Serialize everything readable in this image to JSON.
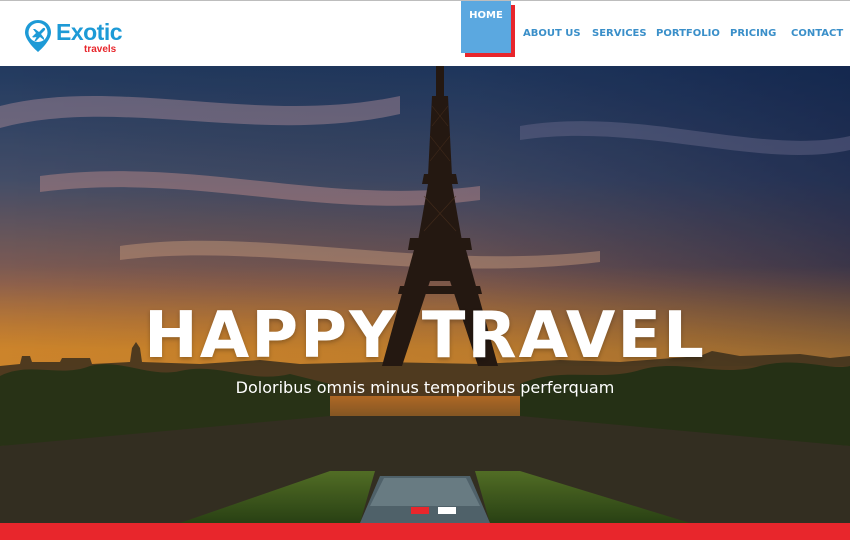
{
  "brand": {
    "name": "Exotic",
    "tagline": "travels",
    "primary_color": "#1d9ad6",
    "accent_color": "#e8262c"
  },
  "nav": {
    "items": [
      {
        "label": "HOME",
        "active": true
      },
      {
        "label": "ABOUT US",
        "active": false
      },
      {
        "label": "SERVICES",
        "active": false
      },
      {
        "label": "PORTFOLIO",
        "active": false
      },
      {
        "label": "PRICING",
        "active": false
      },
      {
        "label": "CONTACT",
        "active": false
      }
    ]
  },
  "hero": {
    "title": "HAPPY TRAVEL",
    "subtitle": "Doloribus omnis minus temporibus perferquam",
    "image": "eiffel-tower-sunset",
    "slides": {
      "count": 2,
      "active": 1
    }
  }
}
